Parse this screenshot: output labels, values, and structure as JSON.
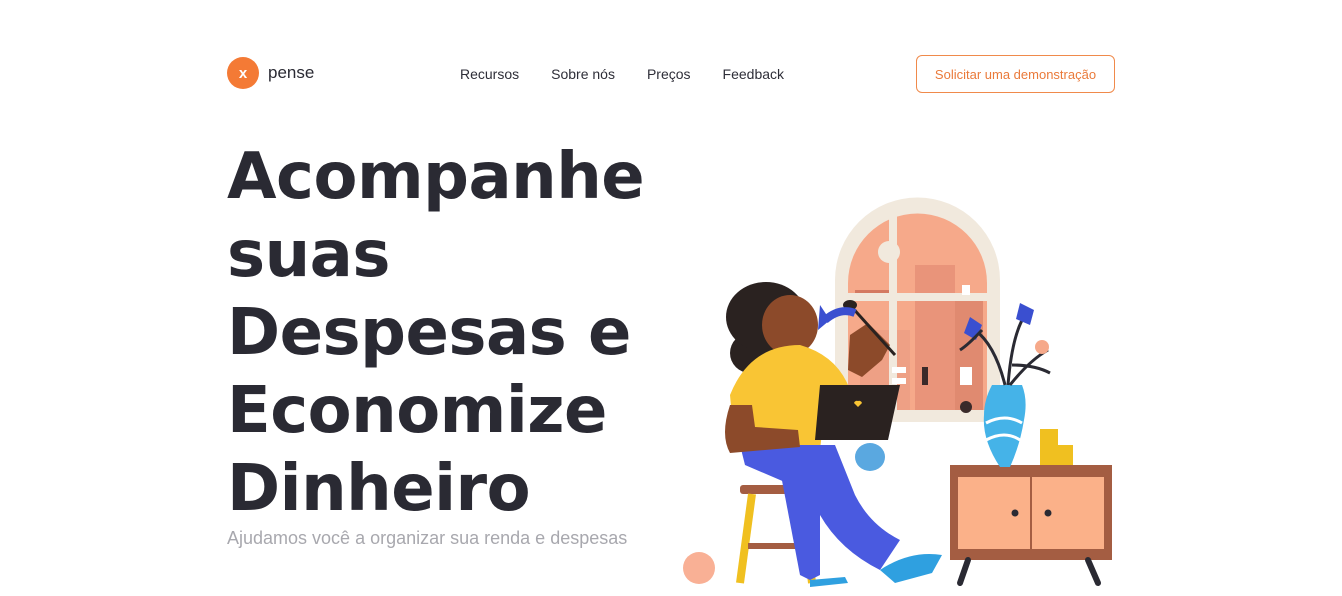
{
  "brand": {
    "mark": "x",
    "name": "pense"
  },
  "nav": {
    "items": [
      {
        "label": "Recursos"
      },
      {
        "label": "Sobre nós"
      },
      {
        "label": "Preços"
      },
      {
        "label": "Feedback"
      }
    ],
    "cta_label": "Solicitar uma demonstração"
  },
  "hero": {
    "title_lines": [
      "Acompanhe",
      "suas",
      "Despesas e",
      "Economize",
      "Dinheiro"
    ],
    "subtitle": "Ajudamos você a organizar sua renda e despesas"
  },
  "colors": {
    "accent": "#f47a35",
    "heading": "#2a2a33",
    "subtitle": "#a8a8ae"
  }
}
